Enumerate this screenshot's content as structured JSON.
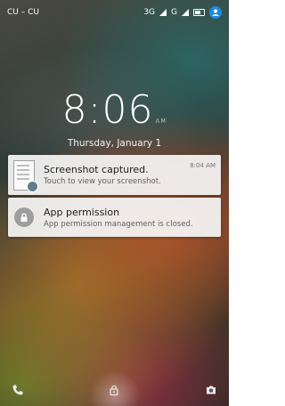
{
  "status_bar": {
    "carrier": "CU – CU",
    "network": "3G",
    "network2": "G"
  },
  "clock": {
    "time": "8:06",
    "ampm": "AM",
    "date": "Thursday, January 1"
  },
  "notifications": [
    {
      "title": "Screenshot captured.",
      "text": "Touch to view your screenshot.",
      "time": "8:04 AM",
      "icon": "screenshot-thumbnail-icon"
    },
    {
      "title": "App permission",
      "text": "App permission management is closed.",
      "icon": "lock-icon"
    }
  ],
  "bottom_bar": {
    "left_icon": "phone-icon",
    "center_icon": "unlock-icon",
    "right_icon": "camera-icon"
  },
  "colors": {
    "user_icon": "#1e88e5",
    "notification_bg": "#f5f5f5"
  }
}
